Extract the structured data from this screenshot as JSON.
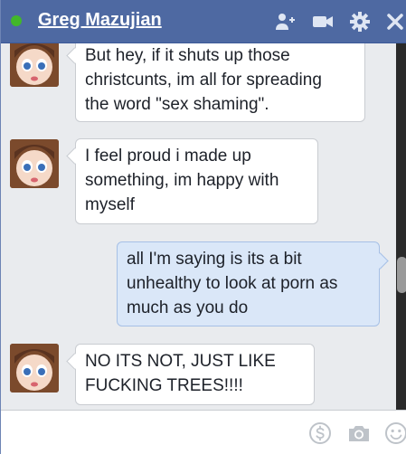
{
  "header": {
    "contact_name": "Greg Mazujian",
    "presence_color": "#42b72a",
    "bar_color": "#4e69a2",
    "icons": [
      "add-user-icon",
      "video-call-icon",
      "gear-icon",
      "close-icon"
    ]
  },
  "messages": [
    {
      "direction": "incoming",
      "text": "But hey, if it shuts up those\nchristcunts, im all for spreading\nthe word \"sex shaming\"."
    },
    {
      "direction": "incoming",
      "text": "I feel proud i made up\nsomething, im happy with\nmyself"
    },
    {
      "direction": "outgoing",
      "text": "all I'm saying is its a bit\nunhealthy to look at porn as\nmuch as you do"
    },
    {
      "direction": "incoming",
      "text": "NO ITS NOT, JUST LIKE\nFUCKING TREES!!!!"
    }
  ],
  "composer": {
    "value": "",
    "icons": [
      "payment-icon",
      "camera-icon",
      "emoji-icon"
    ]
  }
}
